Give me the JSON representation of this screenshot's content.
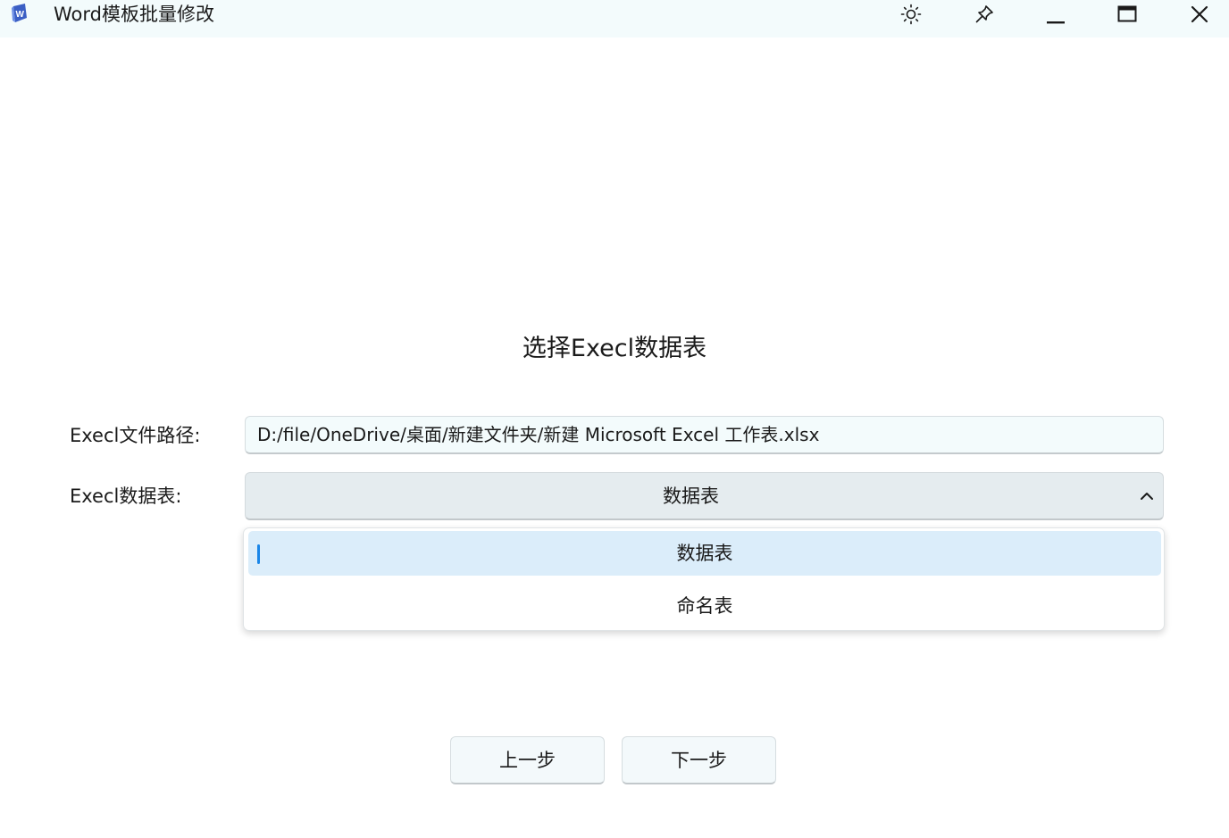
{
  "window": {
    "title": "Word模板批量修改",
    "icons": {
      "app": "word-app-icon",
      "theme": "sun-icon",
      "pin": "pin-icon",
      "minimize": "minimize-icon",
      "maximize": "maximize-icon",
      "close": "close-icon"
    }
  },
  "page": {
    "heading": "选择Execl数据表"
  },
  "form": {
    "path_label": "Execl文件路径:",
    "path_value": "D:/file/OneDrive/桌面/新建文件夹/新建 Microsoft Excel 工作表.xlsx",
    "sheet_label": "Execl数据表:",
    "sheet_selected": "数据表",
    "sheet_options": [
      "数据表",
      "命名表"
    ],
    "chevron_icon": "chevron-up-icon"
  },
  "buttons": {
    "prev": "上一步",
    "next": "下一步"
  },
  "colors": {
    "titlebar_bg": "#f3fbfc",
    "accent": "#1a86e8",
    "selected_option_bg": "#dbedfa",
    "combo_bg": "#e5ecef"
  }
}
